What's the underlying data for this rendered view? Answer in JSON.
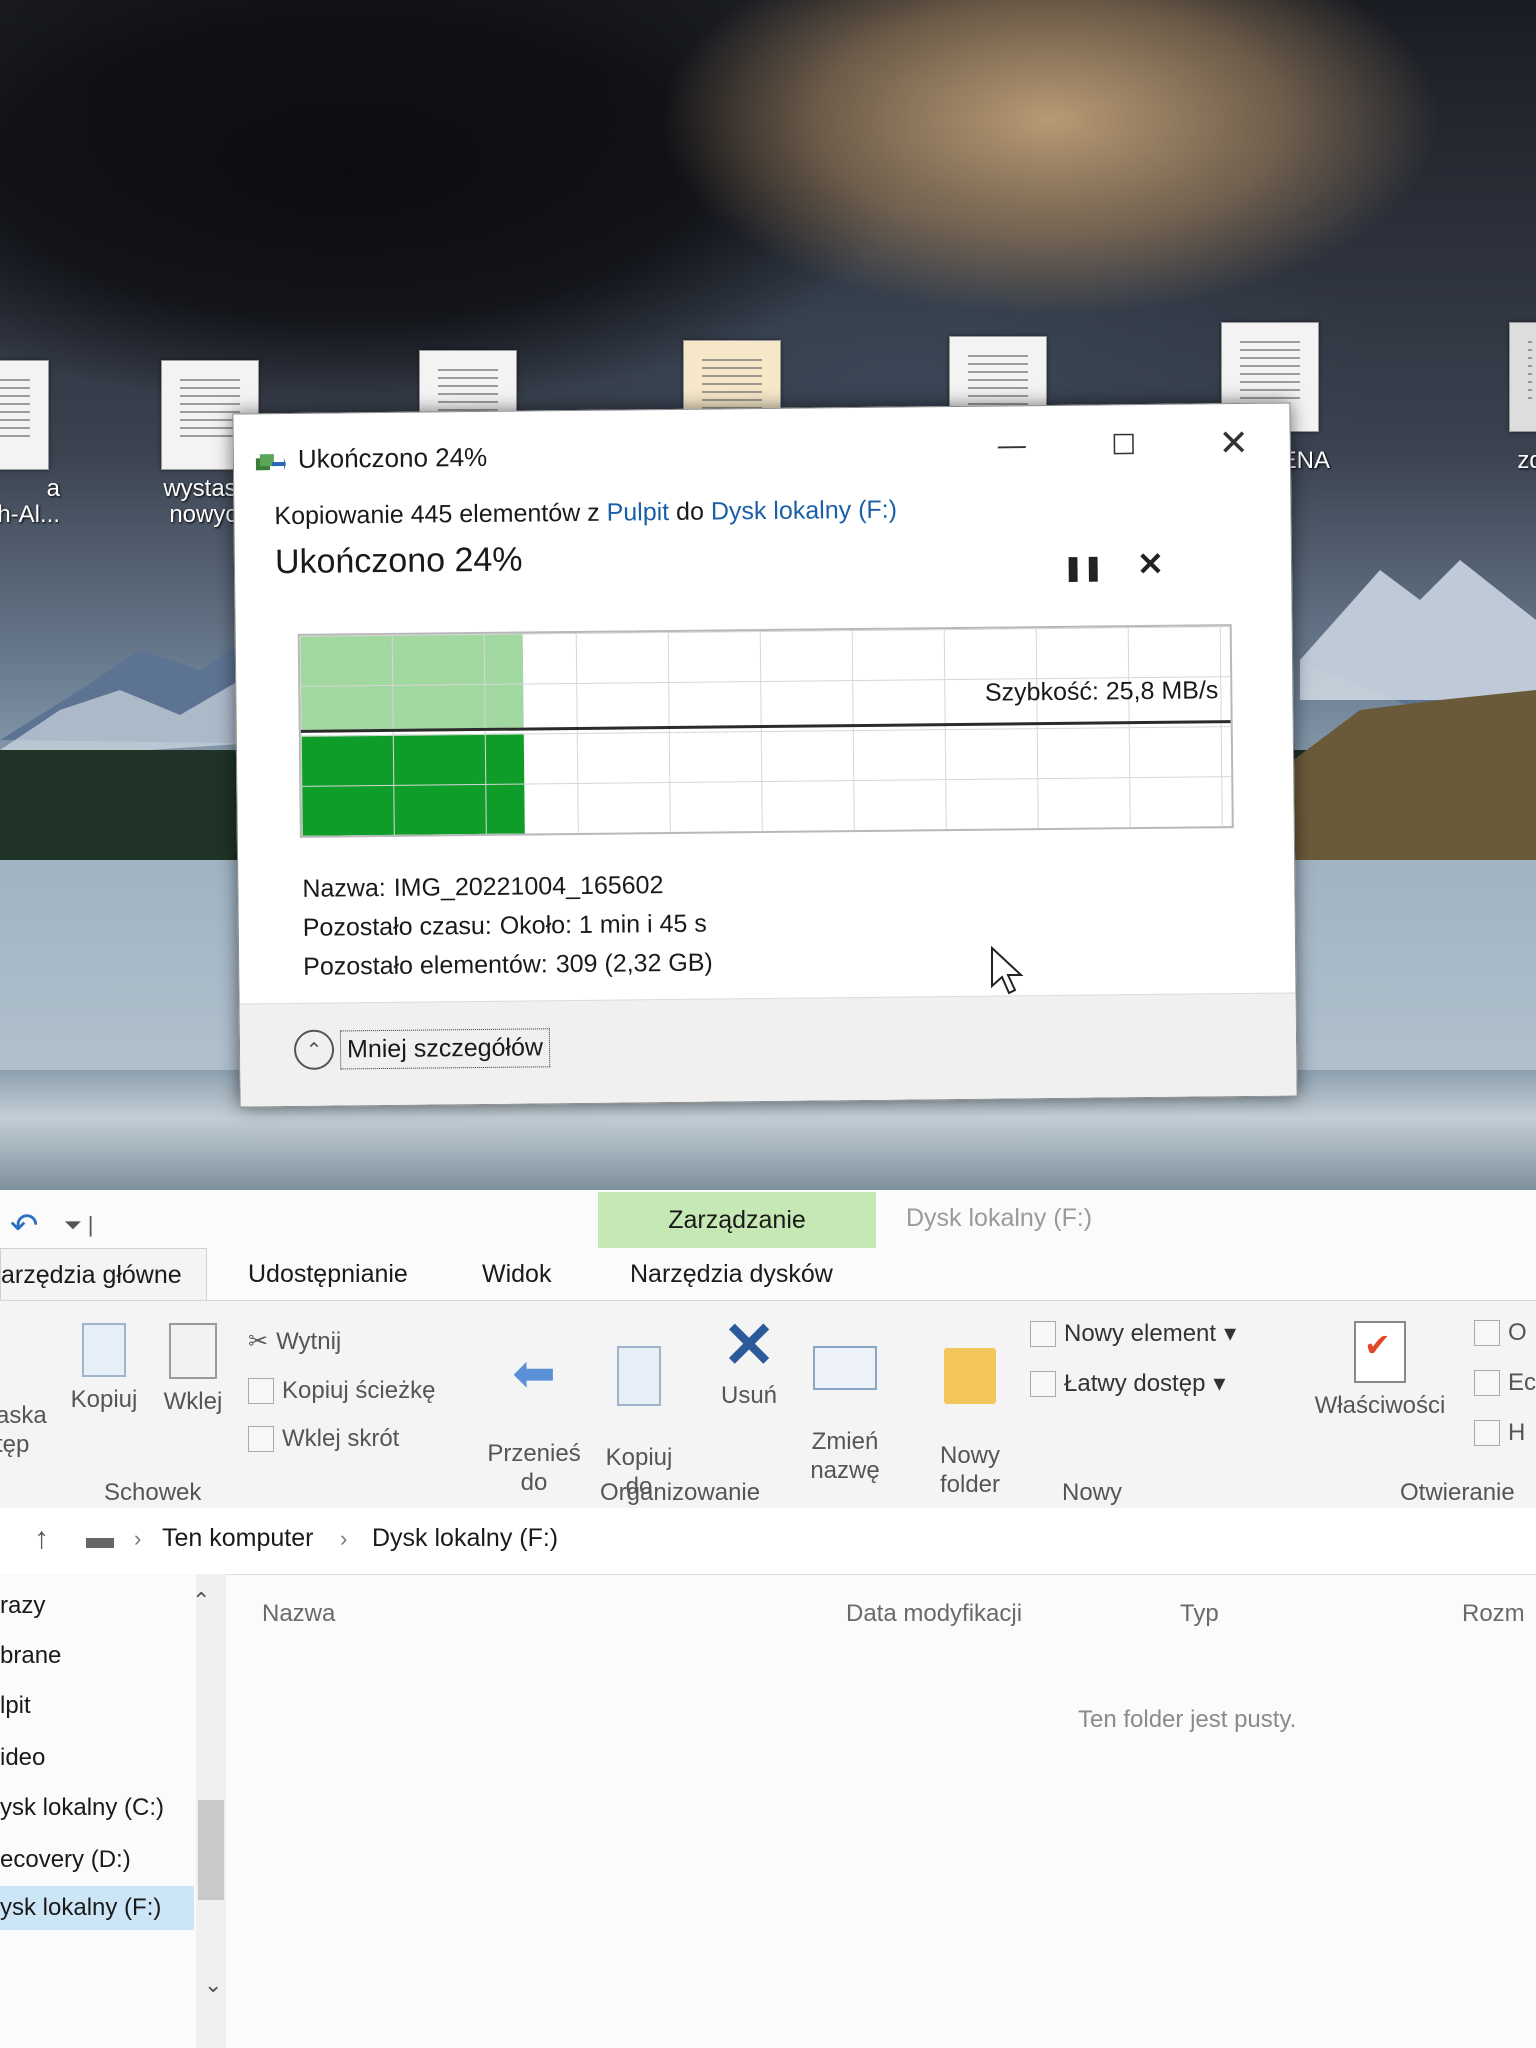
{
  "desktop": {
    "icons": [
      {
        "label": "a\nh-Al..."
      },
      {
        "label": "wystasta\nnowych"
      },
      {
        "label": ""
      },
      {
        "label": ""
      },
      {
        "label": ""
      },
      {
        "label": "YGENA"
      },
      {
        "label": "zd"
      }
    ]
  },
  "dialog": {
    "title": "Ukończono 24%",
    "window_buttons": {
      "minimize": "—",
      "maximize": "☐",
      "close": "✕"
    },
    "copy_prefix": "Kopiowanie 445 elementów z ",
    "copy_source": "Pulpit",
    "copy_mid": " do ",
    "copy_dest": "Dysk lokalny (F:)",
    "status": "Ukończono 24%",
    "pause_icon": "pause-icon",
    "stop_icon": "close-icon",
    "progress_percent": 24,
    "speed_label": "Szybkość: 25,8 MB/s",
    "details": {
      "name_label": "Nazwa:",
      "name_value": "IMG_20221004_165602",
      "time_label": "Pozostało czasu:",
      "time_value": "Około: 1 min i 45 s",
      "items_label": "Pozostało elementów:",
      "items_value": "309 (2,32 GB)"
    },
    "less_details": "Mniej szczegółów"
  },
  "explorer": {
    "title": "Dysk lokalny (F:)",
    "context_tab": "Zarządzanie",
    "tabs": [
      "arzędzia główne",
      "Udostępnianie",
      "Widok",
      "Narzędzia dysków"
    ],
    "ribbon": {
      "paste_partial": "aska\ntęp",
      "copy": "Kopiuj",
      "paste": "Wklej",
      "cut": "Wytnij",
      "copy_path": "Kopiuj ścieżkę",
      "paste_shortcut": "Wklej skrót",
      "move_to": "Przenieś\ndo",
      "copy_to": "Kopiuj\ndo",
      "delete": "Usuń",
      "rename": "Zmień\nnazwę",
      "new_folder": "Nowy\nfolder",
      "new_item": "Nowy element",
      "easy_access": "Łatwy dostęp",
      "properties": "Właściwości",
      "open_partial_1": "O",
      "open_partial_2": "Ec",
      "open_partial_3": "H",
      "groups": {
        "clipboard": "Schowek",
        "organize": "Organizowanie",
        "new": "Nowy",
        "open": "Otwieranie"
      }
    },
    "address": {
      "crumbs": [
        "Ten komputer",
        "Dysk lokalny (F:)"
      ]
    },
    "nav": [
      "razy",
      "brane",
      "lpit",
      "ideo",
      "ysk lokalny (C:)",
      "ecovery (D:)",
      "ysk lokalny (F:)"
    ],
    "columns": [
      "Nazwa",
      "Data modyfikacji",
      "Typ",
      "Rozm"
    ],
    "empty_message": "Ten folder jest pusty."
  },
  "colors": {
    "progress_light": "#8fd18f",
    "progress_dark": "#0f9d2a",
    "link": "#1a5fa8",
    "context_tab": "#c5e8b5"
  }
}
